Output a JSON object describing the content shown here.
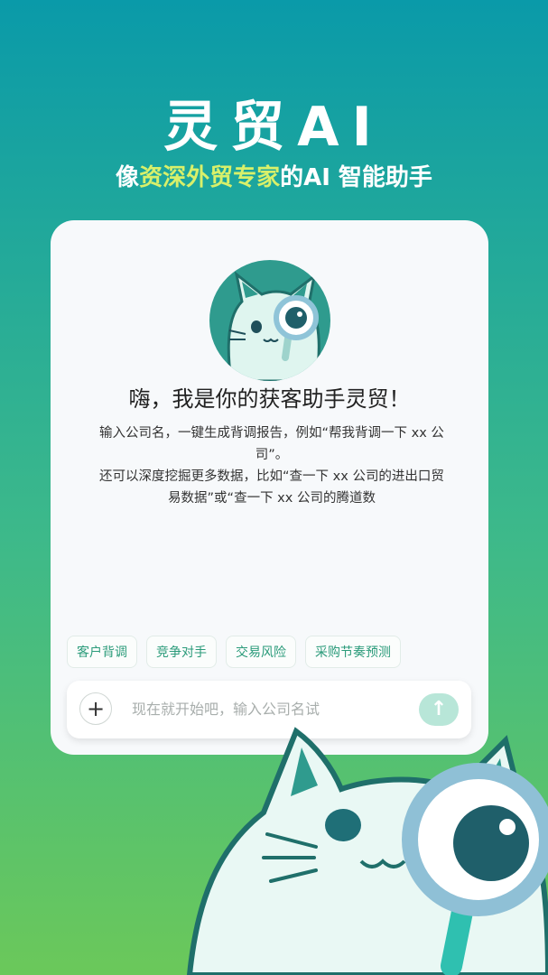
{
  "header": {
    "title": "灵贸AI",
    "subtitle_prefix": "像",
    "subtitle_highlight": "资深外贸专家",
    "subtitle_suffix": "的AI 智能助手"
  },
  "card": {
    "greeting": "嗨，我是你的获客助手灵贸！",
    "desc_line1": "输入公司名，一键生成背调报告，例如“帮我背调一下 xx 公司”。",
    "desc_line2": "还可以深度挖掘更多数据，比如“查一下 xx 公司的进出口贸易数据”或“查一下 xx 公司的腾道数"
  },
  "chips": [
    "客户背调",
    "竞争对手",
    "交易风险",
    "采购节奏预测"
  ],
  "input": {
    "plus_label": "+",
    "placeholder": "现在就开始吧，输入公司名试",
    "send_label": "↑"
  },
  "colors": {
    "accent": "#2b9b7a",
    "highlight": "#d8f06a",
    "mascot": "#2f9b8e"
  }
}
